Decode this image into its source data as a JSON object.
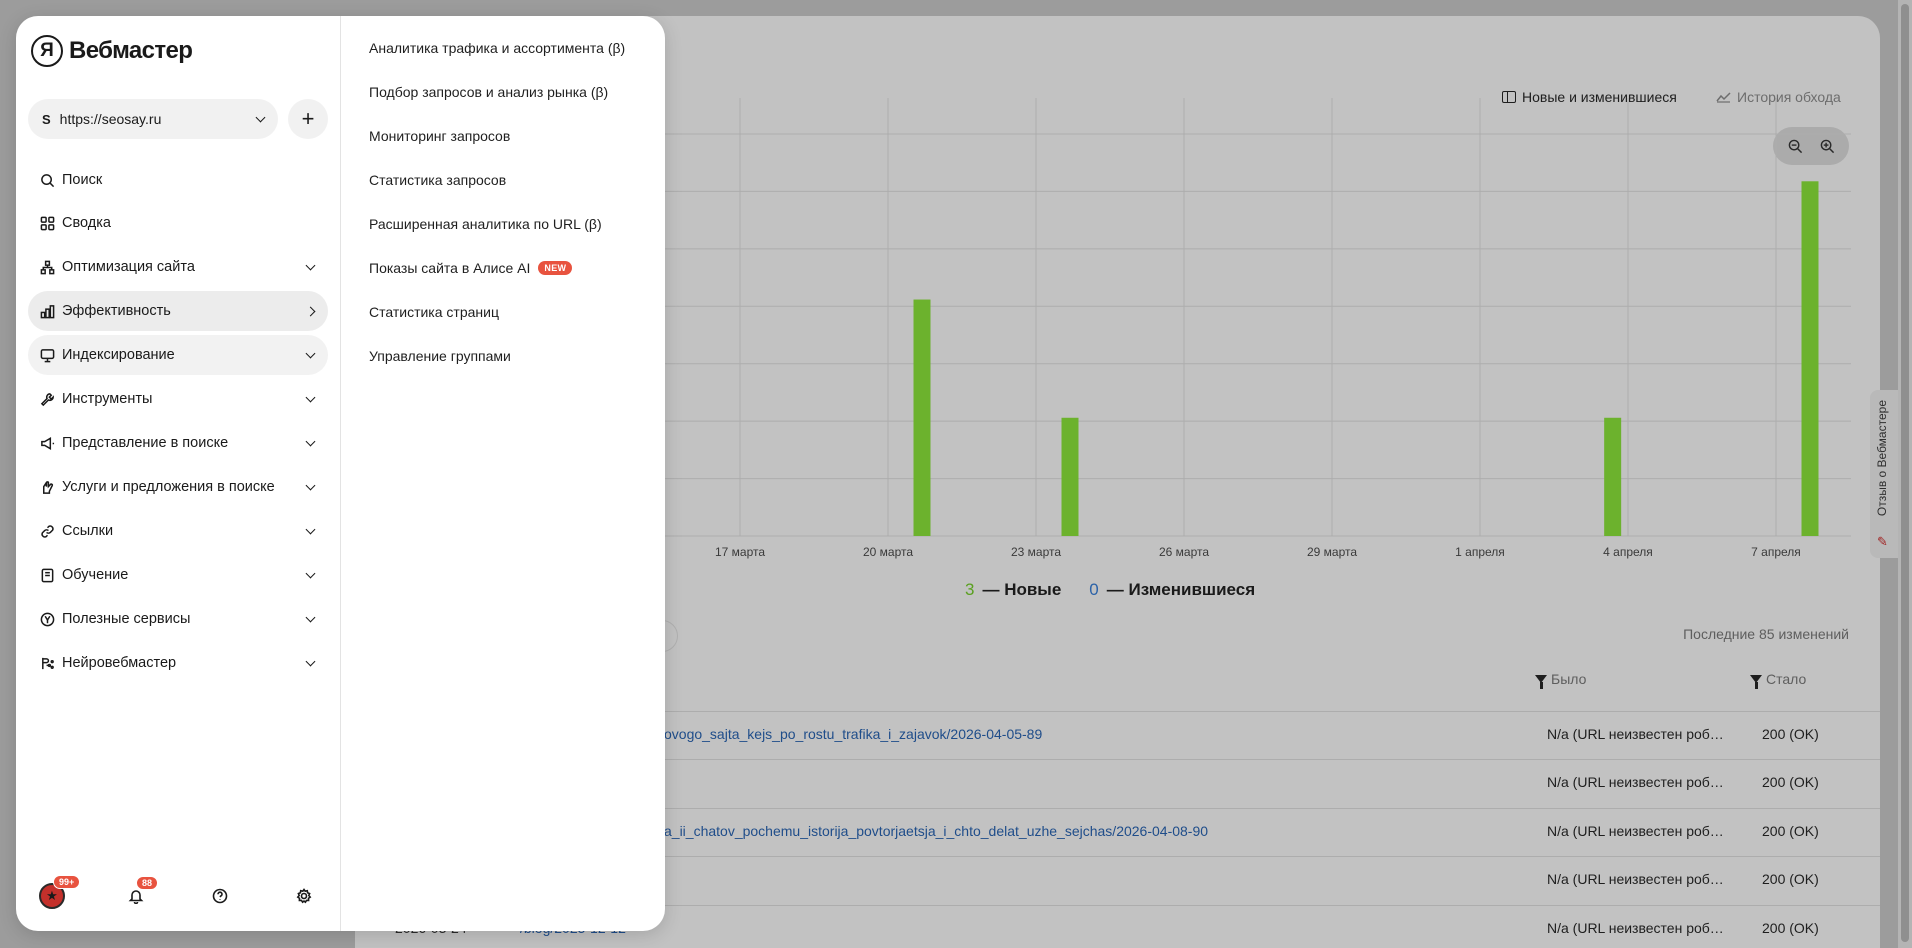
{
  "background": {
    "view_switch": {
      "active_label": "Новые и изменившиеся",
      "inactive_label": "История обхода"
    },
    "zoom": {
      "zoom_out": "−",
      "zoom_in": "+"
    },
    "chart_data": {
      "type": "bar",
      "x_tick_labels": [
        "17 марта",
        "20 марта",
        "23 марта",
        "26 марта",
        "29 марта",
        "1 апреля",
        "4 апреля",
        "7 апреля"
      ],
      "series": [
        {
          "values": [
            {
              "date": "20 марта",
              "value": 2
            },
            {
              "date": "23 марта",
              "value": 1
            },
            {
              "date": "4 апреля",
              "value": 1
            },
            {
              "date": "7 апреля",
              "value": 3
            }
          ],
          "color": "#6cb22d"
        }
      ],
      "ylim": [
        0,
        3.4
      ],
      "grid": true
    },
    "legend": {
      "new_count": "3",
      "new_label": "— Новые",
      "changed_count": "0",
      "changed_label": "— Изменившиеся"
    },
    "last_changes": "Последние 85 изменений",
    "columns": {
      "was": "Было",
      "now": "Стало"
    },
    "rows": [
      {
        "url": "ovogo_sajta_kejs_po_rostu_trafika_i_zajavok/2026-04-05-89",
        "was": "N/a (URL неизвестен роб…",
        "now": "200 (OK)"
      },
      {
        "url": "",
        "was": "N/a (URL неизвестен роб…",
        "now": "200 (OK)"
      },
      {
        "url": "a_ii_chatov_pochemu_istorija_povtorjaetsja_i_chto_delat_uzhe_sejchas/2026-04-08-90",
        "was": "N/a (URL неизвестен роб…",
        "now": "200 (OK)"
      },
      {
        "url": "",
        "was": "N/a (URL неизвестен роб…",
        "now": "200 (OK)"
      },
      {
        "date": "2026-03-24",
        "url": "/blog/2025-12-12",
        "was": "N/a (URL неизвестен роб…",
        "now": "200 (OK)"
      }
    ],
    "feedback_tab": "Отзыв о Вебмастере"
  },
  "menu": {
    "logo_mark": "Я",
    "logo_text": "Вебмастер",
    "site": {
      "favicon": "S",
      "url": "https://seosay.ru",
      "add": "+"
    },
    "nav": [
      {
        "label": "Поиск",
        "icon": "search-icon"
      },
      {
        "label": "Сводка",
        "icon": "grid-icon"
      },
      {
        "label": "Оптимизация сайта",
        "icon": "sitemap-icon"
      },
      {
        "label": "Эффективность",
        "icon": "bar-chart-icon"
      },
      {
        "label": "Индексирование",
        "icon": "monitor-icon"
      },
      {
        "label": "Инструменты",
        "icon": "wrench-icon"
      },
      {
        "label": "Представление в поиске",
        "icon": "megaphone-icon"
      },
      {
        "label": "Услуги и предложения в поиске",
        "icon": "hand-icon"
      },
      {
        "label": "Ссылки",
        "icon": "link-icon"
      },
      {
        "label": "Обучение",
        "icon": "book-icon"
      },
      {
        "label": "Полезные сервисы",
        "icon": "yandex-icon"
      },
      {
        "label": "Нейровебмастер",
        "icon": "ai-icon"
      }
    ],
    "submenu": [
      {
        "label": "Аналитика трафика и ассортимента (β)"
      },
      {
        "label": "Подбор запросов и анализ рынка (β)"
      },
      {
        "label": "Мониторинг запросов"
      },
      {
        "label": "Статистика запросов"
      },
      {
        "label": "Расширенная аналитика по URL (β)"
      },
      {
        "label": "Показы сайта в Алисе AI",
        "badge": "NEW"
      },
      {
        "label": "Статистика страниц"
      },
      {
        "label": "Управление группами"
      }
    ],
    "bottom": {
      "avatar_badge": "99+",
      "notifications_badge": "88"
    }
  }
}
